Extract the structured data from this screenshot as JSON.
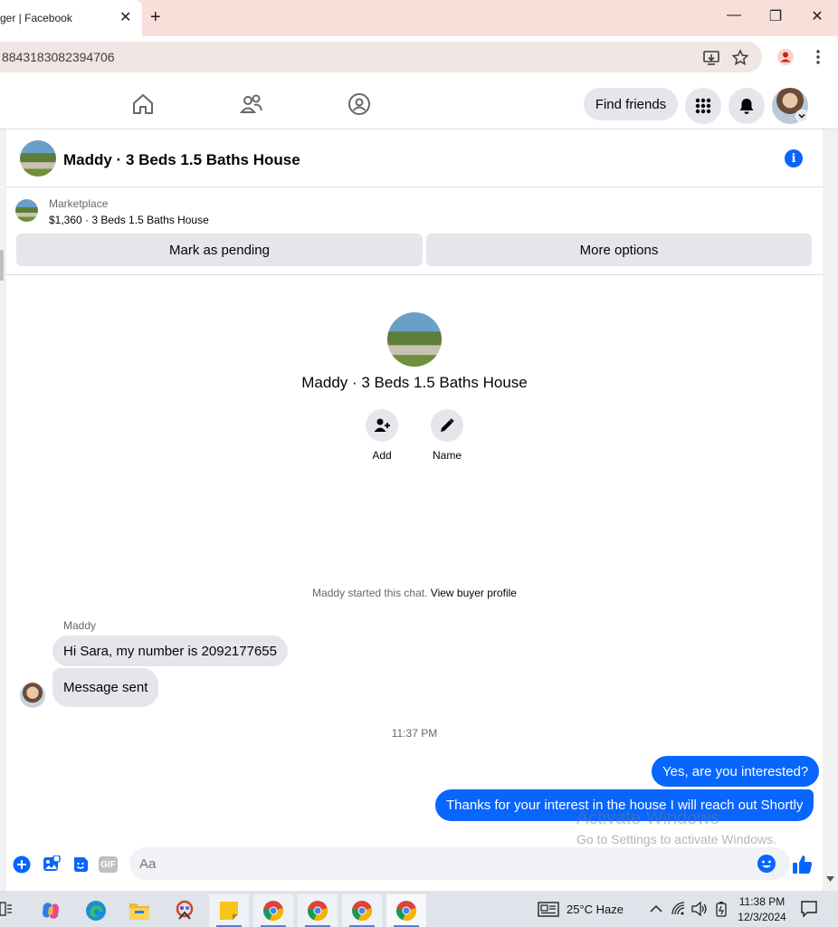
{
  "browser": {
    "tab_title": "ger | Facebook",
    "tab_close": "✕",
    "new_tab": "+",
    "url": "8843183082394706",
    "win_minimize": "—",
    "win_restore": "❐",
    "win_close": "✕"
  },
  "nav": {
    "find_friends": "Find friends"
  },
  "chat": {
    "title": "Maddy · 3 Beds 1.5 Baths House",
    "listing_source": "Marketplace",
    "listing_price": "$1,360 · 3 Beds 1.5 Baths House",
    "mark_pending": "Mark as pending",
    "more_options": "More options",
    "profile_name": "Maddy · 3 Beds 1.5 Baths House",
    "actions": [
      {
        "label": "Add"
      },
      {
        "label": "Name"
      }
    ],
    "started_text": "Maddy started this chat. ",
    "view_buyer_profile": "View buyer profile",
    "sender_name": "Maddy",
    "messages_in": [
      "Hi Sara, my number is 2092177655",
      "Message sent"
    ],
    "timestamp": "11:37 PM",
    "messages_out": [
      "Yes, are you interested?",
      "Thanks for your interest in the house I will reach out Shortly"
    ],
    "composer_placeholder": "Aa",
    "gif_label": "GIF"
  },
  "watermark": {
    "line1": "Activate Windows",
    "line2": "Go to Settings to activate Windows."
  },
  "taskbar": {
    "weather": "25°C  Haze",
    "time": "11:38 PM",
    "date": "12/3/2024"
  },
  "colors": {
    "accent": "#0866ff",
    "bubble_in": "#e4e6eb",
    "tab_bar": "#f9dfd9"
  }
}
